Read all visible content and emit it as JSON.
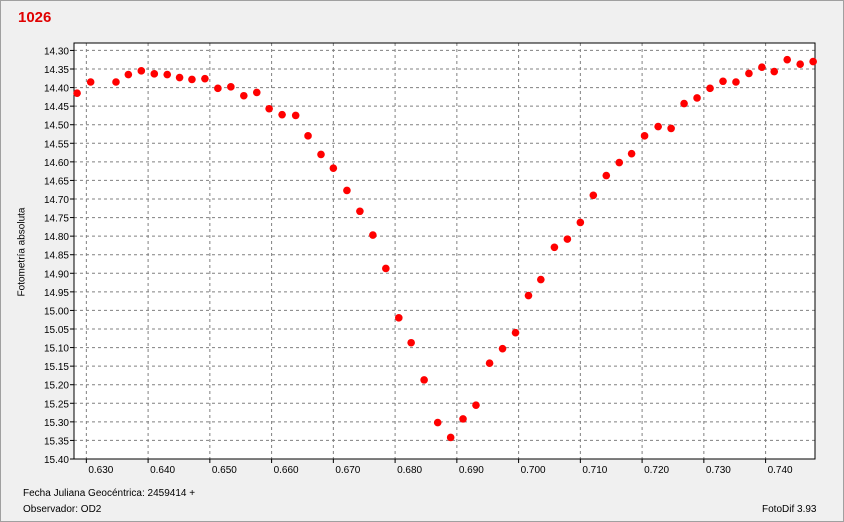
{
  "chart_data": {
    "type": "scatter",
    "title": "1026",
    "xlabel": "Fecha Juliana Geocéntrica: 2459414 +",
    "ylabel": "Fotometría absoluta",
    "xlim": [
      0.628,
      0.748
    ],
    "ylim": [
      14.28,
      15.4
    ],
    "y_inverted": true,
    "grid": true,
    "x_ticks": [
      "0.630",
      "0.640",
      "0.650",
      "0.660",
      "0.670",
      "0.680",
      "0.690",
      "0.700",
      "0.710",
      "0.720",
      "0.730",
      "0.740"
    ],
    "y_ticks": [
      "14.30",
      "14.35",
      "14.40",
      "14.45",
      "14.50",
      "14.55",
      "14.60",
      "14.65",
      "14.70",
      "14.75",
      "14.80",
      "14.85",
      "14.90",
      "14.95",
      "15.00",
      "15.05",
      "15.10",
      "15.15",
      "15.20",
      "15.25",
      "15.30",
      "15.35",
      "15.40"
    ],
    "marker_color": "#ff0000",
    "points": [
      [
        0.6285,
        14.415
      ],
      [
        0.6307,
        14.385
      ],
      [
        0.6348,
        14.385
      ],
      [
        0.6368,
        14.365
      ],
      [
        0.6389,
        14.355
      ],
      [
        0.641,
        14.363
      ],
      [
        0.6431,
        14.365
      ],
      [
        0.6451,
        14.373
      ],
      [
        0.6471,
        14.378
      ],
      [
        0.6492,
        14.376
      ],
      [
        0.6513,
        14.402
      ],
      [
        0.6534,
        14.398
      ],
      [
        0.6555,
        14.422
      ],
      [
        0.6576,
        14.413
      ],
      [
        0.6596,
        14.457
      ],
      [
        0.6617,
        14.473
      ],
      [
        0.6639,
        14.475
      ],
      [
        0.6659,
        14.53
      ],
      [
        0.668,
        14.58
      ],
      [
        0.67,
        14.617
      ],
      [
        0.6722,
        14.677
      ],
      [
        0.6743,
        14.733
      ],
      [
        0.6764,
        14.797
      ],
      [
        0.6785,
        14.887
      ],
      [
        0.6806,
        15.02
      ],
      [
        0.6826,
        15.087
      ],
      [
        0.6847,
        15.187
      ],
      [
        0.6869,
        15.302
      ],
      [
        0.689,
        15.342
      ],
      [
        0.691,
        15.292
      ],
      [
        0.6931,
        15.255
      ],
      [
        0.6953,
        15.142
      ],
      [
        0.6974,
        15.103
      ],
      [
        0.6995,
        15.06
      ],
      [
        0.7016,
        14.96
      ],
      [
        0.7036,
        14.917
      ],
      [
        0.7058,
        14.83
      ],
      [
        0.7079,
        14.808
      ],
      [
        0.71,
        14.763
      ],
      [
        0.7121,
        14.69
      ],
      [
        0.7142,
        14.637
      ],
      [
        0.7163,
        14.602
      ],
      [
        0.7183,
        14.578
      ],
      [
        0.7204,
        14.53
      ],
      [
        0.7226,
        14.505
      ],
      [
        0.7247,
        14.51
      ],
      [
        0.7268,
        14.443
      ],
      [
        0.7289,
        14.428
      ],
      [
        0.731,
        14.402
      ],
      [
        0.7331,
        14.383
      ],
      [
        0.7352,
        14.385
      ],
      [
        0.7373,
        14.362
      ],
      [
        0.7394,
        14.345
      ],
      [
        0.7414,
        14.357
      ],
      [
        0.7435,
        14.325
      ],
      [
        0.7456,
        14.337
      ],
      [
        0.7477,
        14.33
      ]
    ]
  },
  "footer": {
    "fecha_label": "Fecha Juliana Geocéntrica: 2459414 +",
    "observador_label": "Observador: OD2",
    "software_label": "FotoDif 3.93"
  }
}
